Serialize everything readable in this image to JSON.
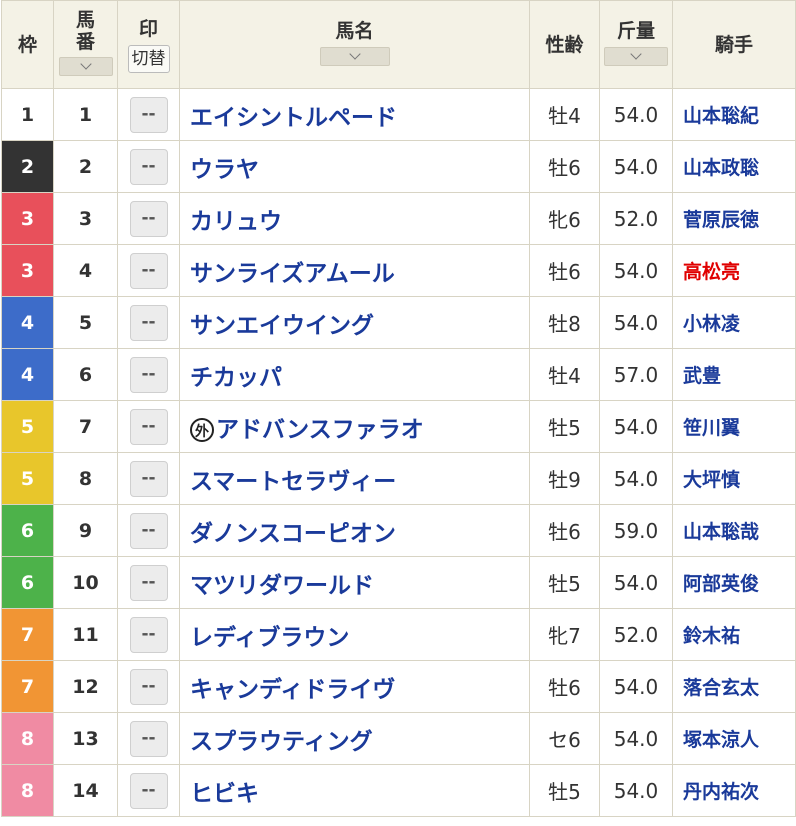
{
  "headers": {
    "waku": "枠",
    "umaban": "馬番",
    "mark": "印",
    "switch_label": "切替",
    "horse": "馬名",
    "sex_age": "性齢",
    "weight": "斤量",
    "jockey": "騎手"
  },
  "mark_placeholder": "--",
  "foreign_badge": "外",
  "rows": [
    {
      "waku": "1",
      "umaban": "1",
      "horse": "エイシントルペード",
      "sex_age": "牡4",
      "weight": "54.0",
      "jockey": "山本聡紀"
    },
    {
      "waku": "2",
      "umaban": "2",
      "horse": "ウラヤ",
      "sex_age": "牡6",
      "weight": "54.0",
      "jockey": "山本政聡"
    },
    {
      "waku": "3",
      "umaban": "3",
      "horse": "カリュウ",
      "sex_age": "牝6",
      "weight": "52.0",
      "jockey": "菅原辰徳"
    },
    {
      "waku": "3",
      "umaban": "4",
      "horse": "サンライズアムール",
      "sex_age": "牡6",
      "weight": "54.0",
      "jockey": "高松亮"
    },
    {
      "waku": "4",
      "umaban": "5",
      "horse": "サンエイウイング",
      "sex_age": "牡8",
      "weight": "54.0",
      "jockey": "小林凌"
    },
    {
      "waku": "4",
      "umaban": "6",
      "horse": "チカッパ",
      "sex_age": "牡4",
      "weight": "57.0",
      "jockey": "武豊"
    },
    {
      "waku": "5",
      "umaban": "7",
      "horse": "アドバンスファラオ",
      "sex_age": "牡5",
      "weight": "54.0",
      "jockey": "笹川翼"
    },
    {
      "waku": "5",
      "umaban": "8",
      "horse": "スマートセラヴィー",
      "sex_age": "牡9",
      "weight": "54.0",
      "jockey": "大坪慎"
    },
    {
      "waku": "6",
      "umaban": "9",
      "horse": "ダノンスコーピオン",
      "sex_age": "牡6",
      "weight": "59.0",
      "jockey": "山本聡哉"
    },
    {
      "waku": "6",
      "umaban": "10",
      "horse": "マツリダワールド",
      "sex_age": "牡5",
      "weight": "54.0",
      "jockey": "阿部英俊"
    },
    {
      "waku": "7",
      "umaban": "11",
      "horse": "レディブラウン",
      "sex_age": "牝7",
      "weight": "52.0",
      "jockey": "鈴木祐"
    },
    {
      "waku": "7",
      "umaban": "12",
      "horse": "キャンディドライヴ",
      "sex_age": "牡6",
      "weight": "54.0",
      "jockey": "落合玄太"
    },
    {
      "waku": "8",
      "umaban": "13",
      "horse": "スプラウティング",
      "sex_age": "セ6",
      "weight": "54.0",
      "jockey": "塚本涼人"
    },
    {
      "waku": "8",
      "umaban": "14",
      "horse": "ヒビキ",
      "sex_age": "牡5",
      "weight": "54.0",
      "jockey": "丹内祐次"
    }
  ],
  "colors": {
    "waku_1": "#ffffff",
    "waku_2": "#333333",
    "waku_3": "#e8505b",
    "waku_4": "#3d6cc9",
    "waku_5": "#e8c62b",
    "waku_6": "#4db24a",
    "waku_7": "#f19534",
    "waku_8": "#f08ba3",
    "link_blue": "#1a3a9a",
    "jockey_highlight_red": "#e00000",
    "header_bg": "#f4f2e6"
  },
  "icons": {
    "sort": "chevron-down-icon",
    "foreign": "foreign-horse-badge-icon"
  }
}
